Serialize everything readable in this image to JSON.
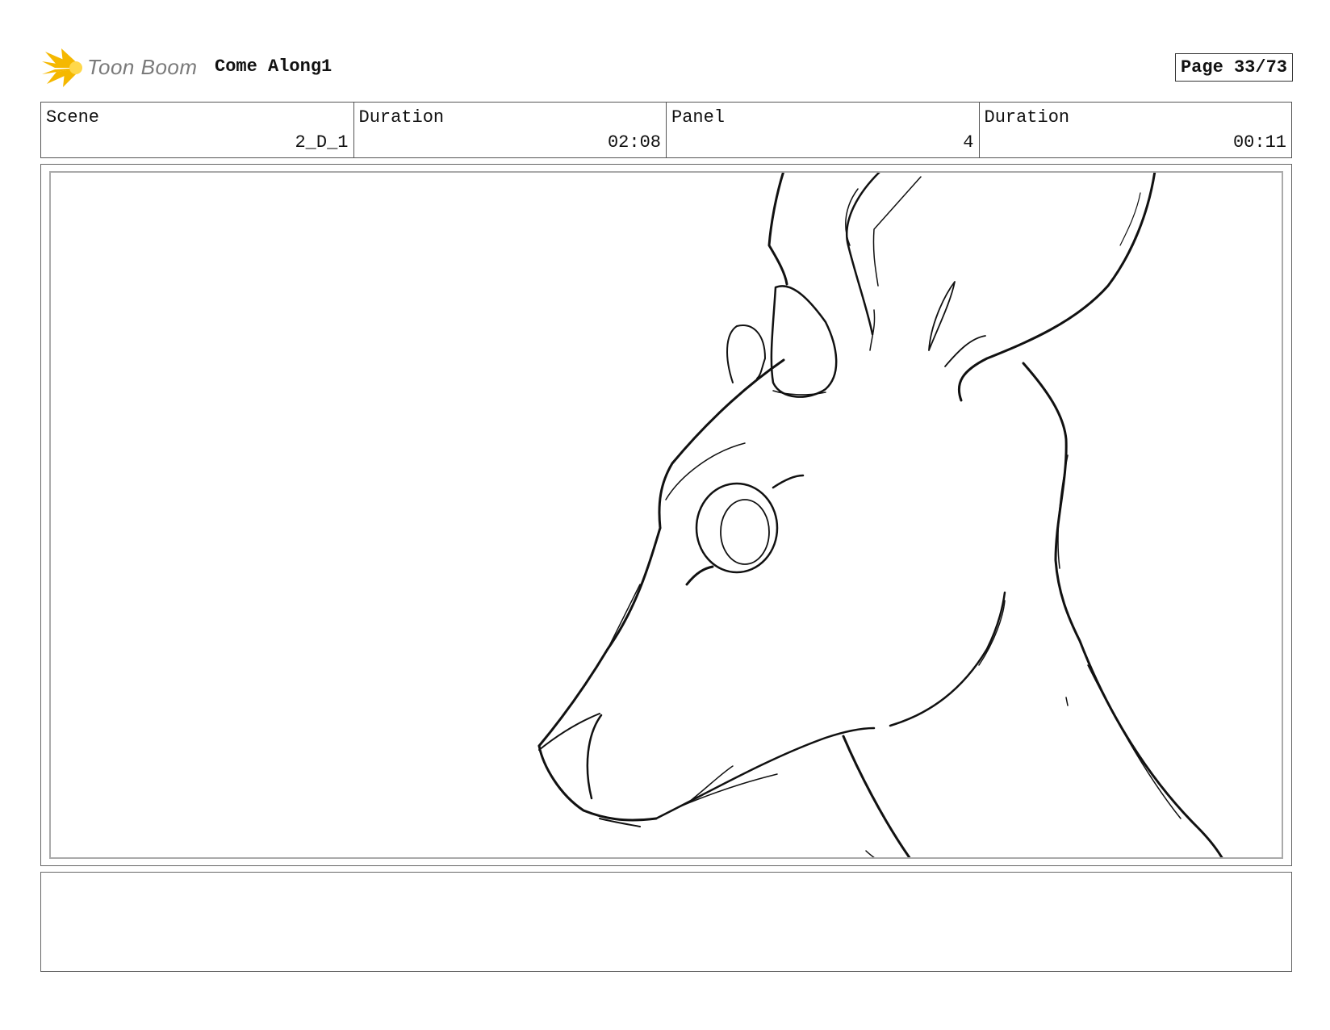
{
  "header": {
    "logo_text": "Toon Boom",
    "project_title": "Come Along1",
    "page_label": "Page 33/73"
  },
  "info": [
    {
      "label": "Scene",
      "value": "2_D_1"
    },
    {
      "label": "Duration",
      "value": "02:08"
    },
    {
      "label": "Panel",
      "value": "4"
    },
    {
      "label": "Duration",
      "value": "00:11"
    }
  ],
  "colors": {
    "logo_accent": "#f5b800",
    "logo_text": "#7a7a7a",
    "border": "#555555"
  },
  "panel": {
    "drawing": "sketch of an antelope head in profile"
  },
  "notes": {
    "text": ""
  }
}
